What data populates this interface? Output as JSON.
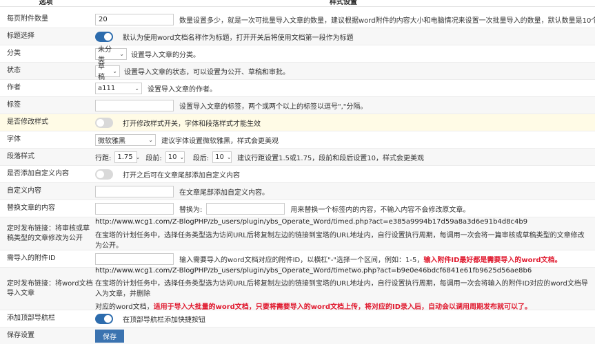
{
  "header": {
    "col1": "选项",
    "col2": "样式设置"
  },
  "rows": {
    "per_page": {
      "label": "每页附件数量",
      "value": "20",
      "hint": "数量设置多少，就是一次可批量导入文章的数量，建议根据word附件的内容大小和电脑情况来设置一次批量导入的数量，默认数量是10个。"
    },
    "title_select": {
      "label": "标题选择",
      "toggle": "on",
      "hint": "默认为使用word文档名称作为标题，打开开关后将使用文档第一段作为标题"
    },
    "category": {
      "label": "分类",
      "selected": "未分类",
      "hint": "设置导入文章的分类。"
    },
    "status": {
      "label": "状态",
      "selected": "草稿",
      "hint": "设置导入文章的状态，可以设置为公开、草稿和审批。"
    },
    "author": {
      "label": "作者",
      "selected": "a111",
      "hint": "设置导入文章的作者。"
    },
    "tags": {
      "label": "标签",
      "value": "",
      "hint": "设置导入文章的标签，两个或两个以上的标签以逗号\",\"分隔。"
    },
    "modify_style": {
      "label": "是否修改样式",
      "toggle": "off",
      "hint": "打开修改样式开关，字体和段落样式才能生效"
    },
    "font": {
      "label": "字体",
      "selected": "微软雅黑",
      "hint": "建议字体设置微软雅黑，样式会更美观"
    },
    "paragraph": {
      "label": "段落样式",
      "line_label": "行距:",
      "line_value": "1.75",
      "before_label": "段前:",
      "before_value": "10",
      "after_label": "段后:",
      "after_value": "10",
      "hint": "建议行距设置1.5或1.75，段前和段后设置10，样式会更美观"
    },
    "custom_add": {
      "label": "是否添加自定义内容",
      "toggle": "off",
      "hint": "打开之后可在文章尾部添加自定义内容"
    },
    "custom_content": {
      "label": "自定义内容",
      "value": "",
      "hint": "在文章尾部添加自定义内容。"
    },
    "replace": {
      "label": "替换文章的内容",
      "value": "",
      "replace_label": "替换为:",
      "replace_value": "",
      "hint": "用来替换一个标签内的内容，不输入内容不会修改原文章。"
    },
    "timed1": {
      "label": "定时发布链接：将审核或草稿类型的文章修改为公开",
      "url": "http://www.wcg1.com/Z-BlogPHP/zb_users/plugin/ybs_Operate_Word/timed.php?act=e385a9994b17d59a8a3d6e91b4d8c4b9",
      "desc": "在宝塔的计划任务中，选择任务类型选为访问URL后将复制左边的链接到宝塔的URL地址内，自行设置执行周期，每调用一次会将一篇审核或草稿类型的文章修改为公开。"
    },
    "attach_id": {
      "label": "需导入的附件ID",
      "value": "",
      "hint": "输入需要导入的word文档对应的附件ID，以横杠\"-\"选择一个区间，例如：1-5，",
      "hint_red": "输入附件ID最好都是需要导入的word文档。"
    },
    "timed2": {
      "label": "定时发布链接：将word文档导入文章",
      "url": "http://www.wcg1.com/Z-BlogPHP/zb_users/plugin/ybs_Operate_Word/timetwo.php?act=b9e0e46bdcf6841e61fb9625d56ae8b6",
      "desc1": "在宝塔的计划任务中，选择任务类型选为访问URL后将复制左边的链接到宝塔的URL地址内，自行设置执行周期，每调用一次会将输入的附件ID对应的word文档导入为文章，并删除",
      "desc2": "对应的word文档，",
      "desc_red": "适用于导入大批量的word文档，只要将需要导入的word文档上传，将对应的ID录入后，自动会以调用周期发布就可以了。"
    },
    "top_nav": {
      "label": "添加顶部导航栏",
      "toggle": "on",
      "hint": "在顶部导航栏添加快捷按钮"
    },
    "save": {
      "label": "保存设置",
      "button": "保存"
    }
  },
  "colors": {
    "accent": "#2d6cad",
    "button": "#3b73b0",
    "warning": "#e0192e",
    "highlight_row": "#fffbe6"
  }
}
